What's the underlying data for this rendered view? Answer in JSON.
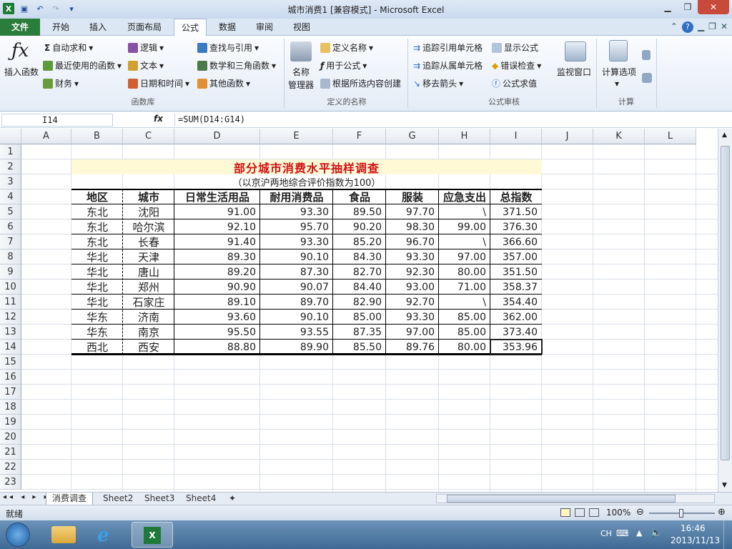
{
  "window": {
    "title": "城市消费1  [兼容模式] - Microsoft Excel"
  },
  "tabs": [
    {
      "label": "文件"
    },
    {
      "label": "开始"
    },
    {
      "label": "插入"
    },
    {
      "label": "页面布局"
    },
    {
      "label": "公式"
    },
    {
      "label": "数据"
    },
    {
      "label": "审阅"
    },
    {
      "label": "视图"
    }
  ],
  "ribbon": {
    "insert_function": "插入函数",
    "function_library": {
      "autosum": "自动求和",
      "recent": "最近使用的函数",
      "financial": "财务",
      "logical": "逻辑",
      "text": "文本",
      "datetime": "日期和时间",
      "lookup": "查找与引用",
      "math": "数学和三角函数",
      "more": "其他函数",
      "group_label": "函数库"
    },
    "defined_names": {
      "name_manager_1": "名称",
      "name_manager_2": "管理器",
      "define_name": "定义名称",
      "use_in_formula": "用于公式",
      "create_from_selection": "根据所选内容创建",
      "group_label": "定义的名称"
    },
    "auditing": {
      "trace_precedents": "追踪引用单元格",
      "trace_dependents": "追踪从属单元格",
      "remove_arrows": "移去箭头",
      "show_formulas": "显示公式",
      "error_checking": "错误检查",
      "evaluate_formula": "公式求值",
      "watch_window": "监视窗口",
      "group_label": "公式审核"
    },
    "calculation": {
      "options": "计算选项",
      "group_label": "计算"
    }
  },
  "formula_bar": {
    "name_box": "I14",
    "fx": "fx",
    "formula": "=SUM(D14:G14)"
  },
  "columns": [
    "A",
    "B",
    "C",
    "D",
    "E",
    "F",
    "G",
    "H",
    "I",
    "J",
    "K",
    "L"
  ],
  "rows": [
    "1",
    "2",
    "3",
    "4",
    "5",
    "6",
    "7",
    "8",
    "9",
    "10",
    "11",
    "12",
    "13",
    "14",
    "15",
    "16",
    "17",
    "18",
    "19",
    "20",
    "21",
    "22",
    "23"
  ],
  "table": {
    "title": "部分城市消费水平抽样调查",
    "subtitle": "（以京沪两地综合评价指数为100）",
    "headers": [
      "地区",
      "城市",
      "日常生活用品",
      "耐用消费品",
      "食品",
      "服装",
      "应急支出",
      "总指数"
    ],
    "rows": [
      [
        "东北",
        "沈阳",
        "91.00",
        "93.30",
        "89.50",
        "97.70",
        "\\",
        "371.50"
      ],
      [
        "东北",
        "哈尔滨",
        "92.10",
        "95.70",
        "90.20",
        "98.30",
        "99.00",
        "376.30"
      ],
      [
        "东北",
        "长春",
        "91.40",
        "93.30",
        "85.20",
        "96.70",
        "\\",
        "366.60"
      ],
      [
        "华北",
        "天津",
        "89.30",
        "90.10",
        "84.30",
        "93.30",
        "97.00",
        "357.00"
      ],
      [
        "华北",
        "唐山",
        "89.20",
        "87.30",
        "82.70",
        "92.30",
        "80.00",
        "351.50"
      ],
      [
        "华北",
        "郑州",
        "90.90",
        "90.07",
        "84.40",
        "93.00",
        "71.00",
        "358.37"
      ],
      [
        "华北",
        "石家庄",
        "89.10",
        "89.70",
        "82.90",
        "92.70",
        "\\",
        "354.40"
      ],
      [
        "华东",
        "济南",
        "93.60",
        "90.10",
        "85.00",
        "93.30",
        "85.00",
        "362.00"
      ],
      [
        "华东",
        "南京",
        "95.50",
        "93.55",
        "87.35",
        "97.00",
        "85.00",
        "373.40"
      ],
      [
        "西北",
        "西安",
        "88.80",
        "89.90",
        "85.50",
        "89.76",
        "80.00",
        "353.96"
      ]
    ]
  },
  "sheet_tabs": [
    "消费调查",
    "Sheet2",
    "Sheet3",
    "Sheet4"
  ],
  "status": {
    "ready": "就绪",
    "zoom": "100%"
  },
  "taskbar": {
    "lang": "CH",
    "time": "16:46",
    "date": "2013/11/13"
  }
}
